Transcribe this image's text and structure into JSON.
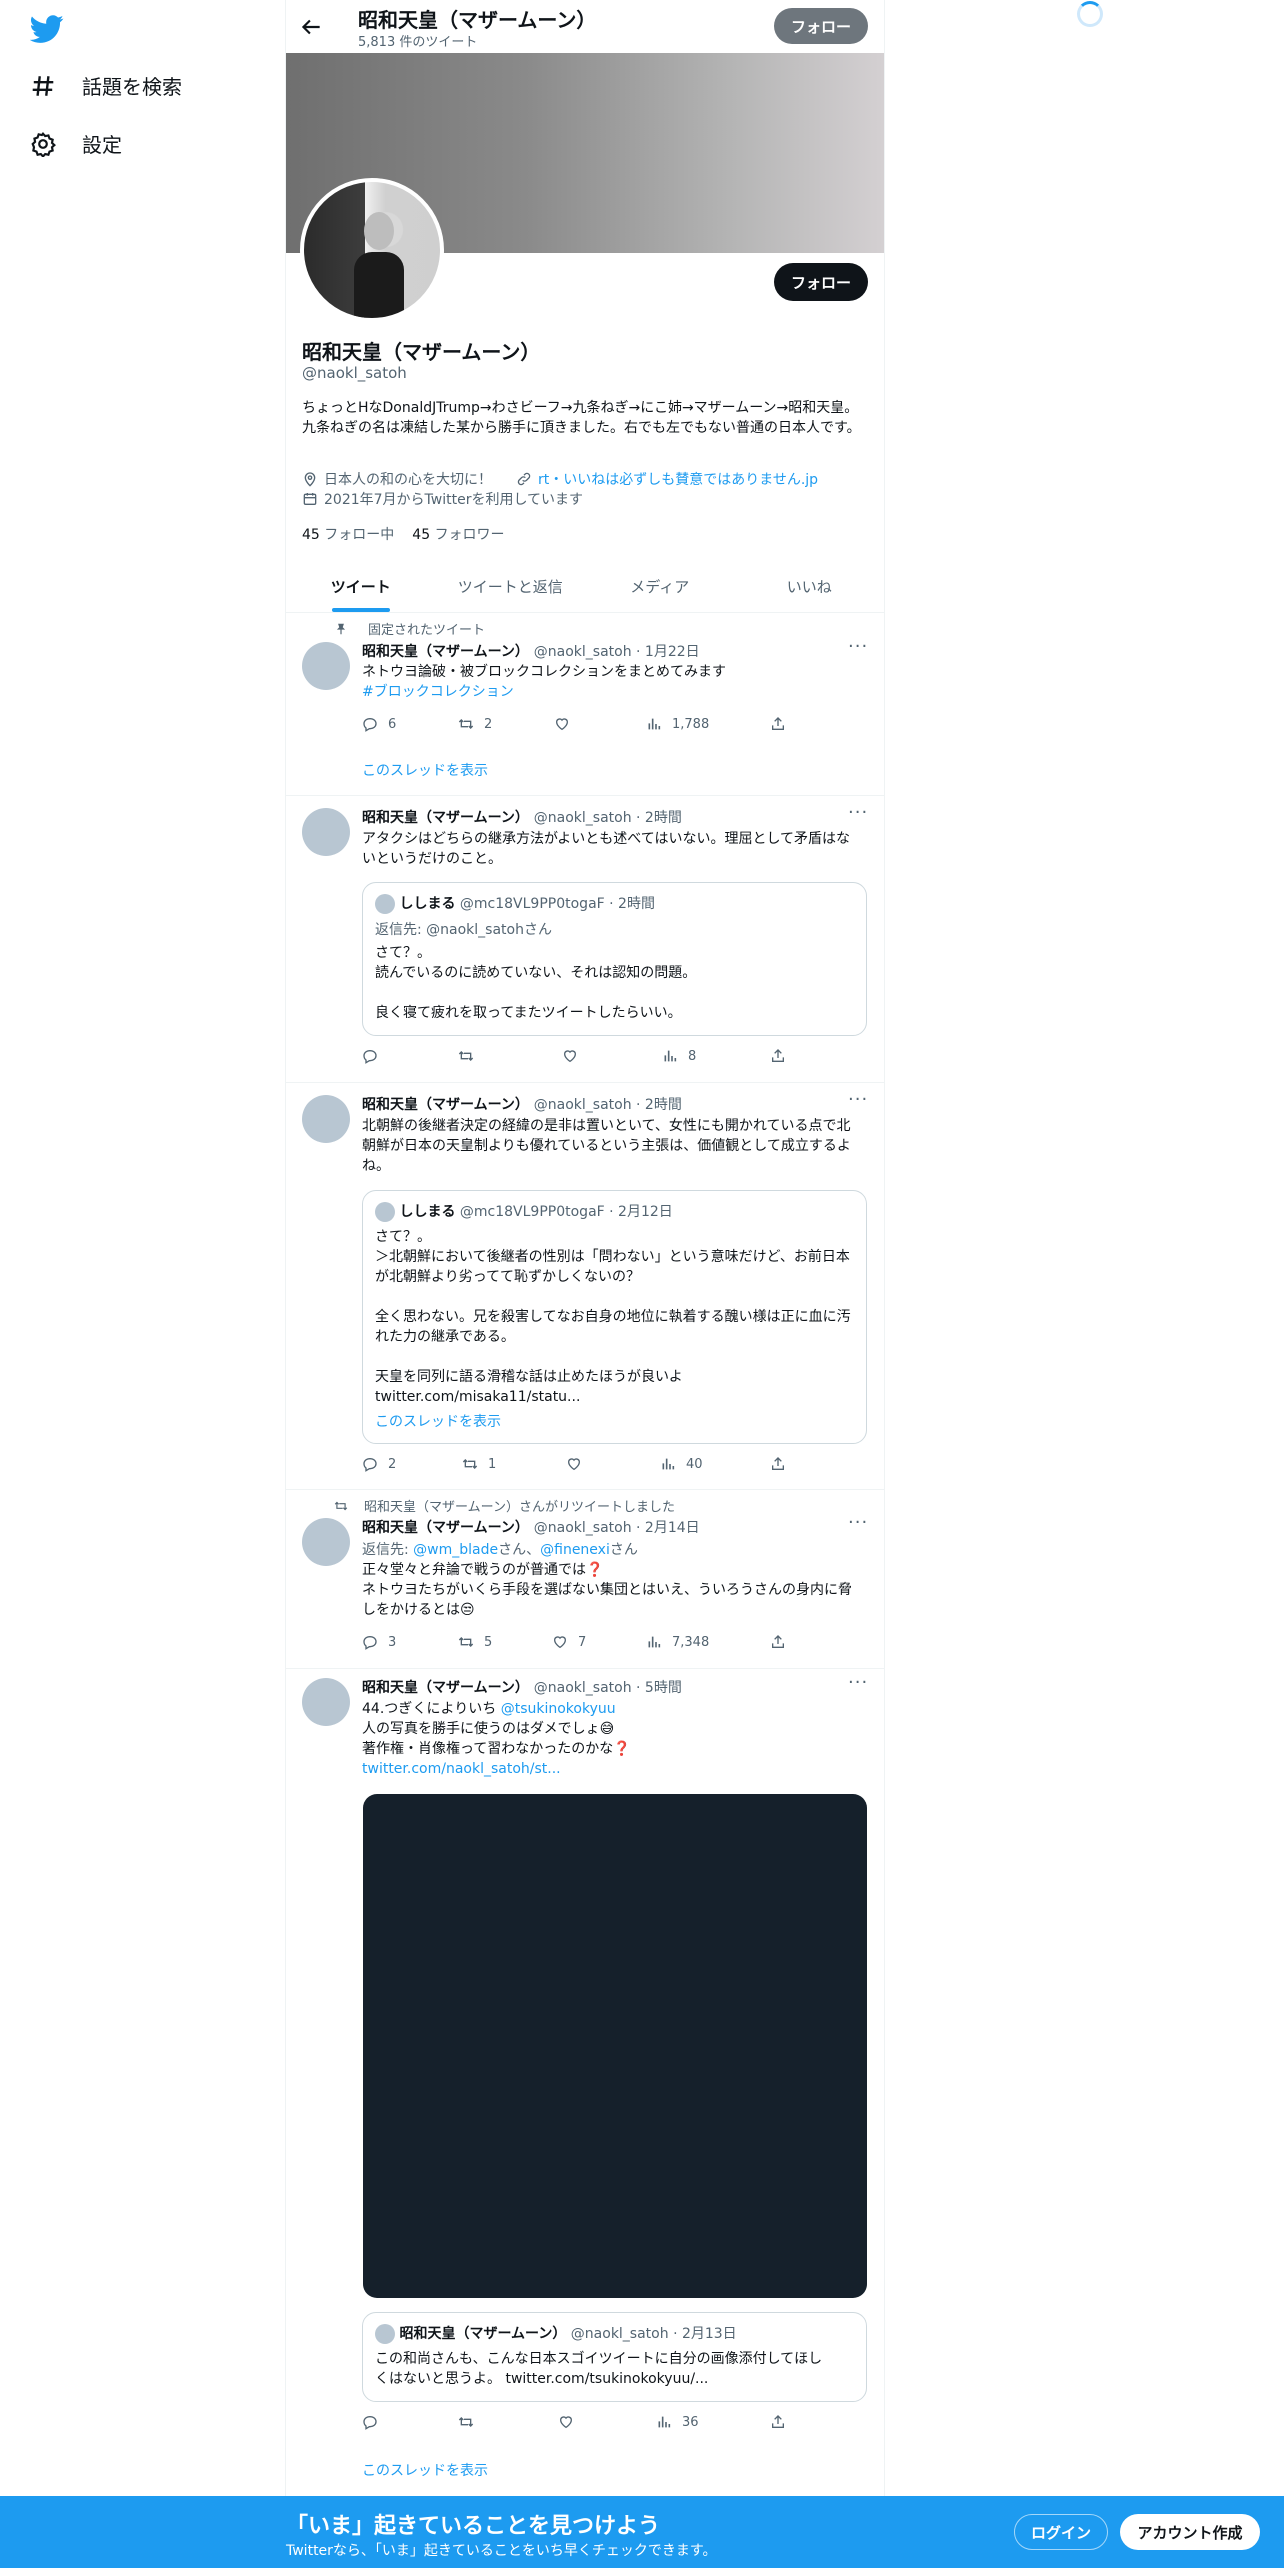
{
  "nav": {
    "explore_label": "話題を検索",
    "settings_label": "設定"
  },
  "header": {
    "name": "昭和天皇（マザームーン）",
    "tweet_count": "5,813 件のツイート",
    "follow_label": "フォロー"
  },
  "profile": {
    "name": "昭和天皇（マザームーン）",
    "handle": "@naokl_satoh",
    "follow_label": "フォロー",
    "bio": "ちょっとHなDonaldJTrump→わさビーフ→九条ねぎ→にこ姉→マザームーン→昭和天皇。九条ねぎの名は凍結した某から勝手に頂きました。右でも左でもない普通の日本人です。",
    "location": "日本人の和の心を大切に！",
    "website": "rt・いいねは必ずしも賛意ではありません.jp",
    "joined": "2021年7月からTwitterを利用しています",
    "following_count": "45",
    "following_label": "フォロー中",
    "followers_count": "45",
    "followers_label": "フォロワー"
  },
  "tabs": [
    "ツイート",
    "ツイートと返信",
    "メディア",
    "いいね"
  ],
  "tweets": [
    {
      "pinned_label": "固定されたツイート",
      "name": "昭和天皇（マザームーン）",
      "meta": "@naokl_satoh · 1月22日",
      "text": "ネトウヨ論破・被ブロックコレクションをまとめてみます",
      "hashtag": "#ブロックコレクション",
      "replies": "6",
      "retweets": "2",
      "likes": "",
      "views": "1,788",
      "thread_label": "このスレッドを表示"
    },
    {
      "name": "昭和天皇（マザームーン）",
      "meta": "@naokl_satoh · 2時間",
      "text": "アタクシはどちらの継承方法がよいとも述べてはいない。理屈として矛盾はないというだけのこと。",
      "quote": {
        "name": "ししまる",
        "meta": "@mc18VL9PP0togaF · 2時間",
        "reply_to": "返信先: @naokl_satohさん",
        "line1": "さて？。",
        "line2": "読んでいるのに読めていない、それは認知の問題。",
        "line3": "良く寝て疲れを取ってまたツイートしたらいい。"
      },
      "replies": "",
      "retweets": "",
      "likes": "",
      "views": "8"
    },
    {
      "name": "昭和天皇（マザームーン）",
      "meta": "@naokl_satoh · 2時間",
      "text": "北朝鮮の後継者決定の経緯の是非は置いといて、女性にも開かれている点で北朝鮮が日本の天皇制よりも優れているという主張は、価値観として成立するよね。",
      "quote": {
        "name": "ししまる",
        "meta": "@mc18VL9PP0togaF · 2月12日",
        "line1": "さて？。",
        "line2": "＞北朝鮮において後継者の性別は「問わない」という意味だけど、お前日本が北朝鮮より劣ってて恥ずかしくないの？",
        "line3": "全く思わない。兄を殺害してなお自身の地位に執着する醜い様は正に血に汚れた力の継承である。",
        "line4": "天皇を同列に語る滑稽な話は止めたほうが良いよ",
        "link": "twitter.com/misaka11/statu...",
        "thread_label": "このスレッドを表示"
      },
      "replies": "2",
      "retweets": "1",
      "likes": "",
      "views": "40"
    },
    {
      "retweeted_label": "昭和天皇（マザームーン）さんがリツイートしました",
      "name": "昭和天皇（マザームーン）",
      "meta": "@naokl_satoh · 2月14日",
      "reply_prefix": "返信先: ",
      "reply_user1": "@wm_blade",
      "reply_mid": "さん、",
      "reply_user2": "@finenexi",
      "reply_suffix": "さん",
      "line1": "正々堂々と弁論で戦うのが普通では❓",
      "line2": "ネトウヨたちがいくら手段を選ばない集団とはいえ、ういろうさんの身内に脅しをかけるとは😒",
      "replies": "3",
      "retweets": "5",
      "likes": "7",
      "views": "7,348"
    },
    {
      "name": "昭和天皇（マザームーン）",
      "meta": "@naokl_satoh · 5時間",
      "line1_prefix": "44.つぎくによりいち ",
      "line1_mention": "@tsukinokokyuu",
      "line2": "人の写真を勝手に使うのはダメでしょ😅",
      "line3": "著作権・肖像権って習わなかったのかな❓",
      "link": "twitter.com/naokl_satoh/st...",
      "quote": {
        "name": "昭和天皇（マザームーン）",
        "meta": "@naokl_satoh · 2月13日",
        "line1": "この和尚さんも、こんな日本スゴイツイートに自分の画像添付してほし",
        "line2": "くはないと思うよ。 twitter.com/tsukinokokyuu/..."
      },
      "replies": "",
      "retweets": "",
      "likes": "",
      "views": "36",
      "thread_label": "このスレッドを表示"
    }
  ],
  "bottom_bar": {
    "title": "「いま」起きていることを見つけよう",
    "subtitle": "Twitterなら、「いま」起きていることをいち早くチェックできます。",
    "login_label": "ログイン",
    "signup_label": "アカウント作成"
  },
  "colors": {
    "accent": "#1d9bf0",
    "text": "#0f1419",
    "muted": "#536471",
    "media_bg": "#15202b"
  }
}
